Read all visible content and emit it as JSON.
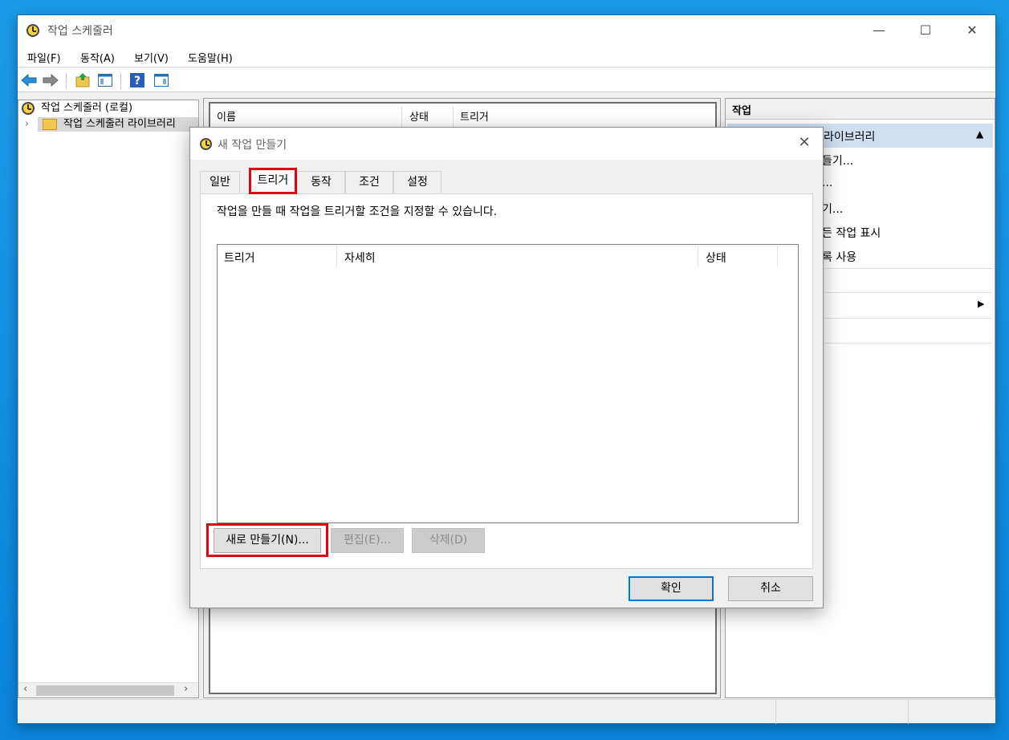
{
  "window": {
    "title": "작업 스케줄러",
    "controls": {
      "minimize": "—",
      "maximize": "☐",
      "close": "✕"
    }
  },
  "menubar": {
    "items": [
      "파일(F)",
      "동작(A)",
      "보기(V)",
      "도움말(H)"
    ]
  },
  "toolbar": {
    "icons": [
      "back-arrow-icon",
      "forward-arrow-icon",
      "up-folder-icon",
      "show-pane-icon",
      "help-icon",
      "show-action-pane-icon"
    ]
  },
  "tree": {
    "root": "작업 스케줄러 (로컬)",
    "child": "작업 스케줄러 라이브러리",
    "expander": "›",
    "scroll_left": "‹",
    "scroll_right": "›"
  },
  "center": {
    "columns": [
      "이름",
      "상태",
      "트리거"
    ]
  },
  "actions": {
    "header": "작업",
    "selected_group": "라이브러리",
    "items": [
      "들기...",
      "...",
      "기...",
      "든 작업 표시",
      "록 사용"
    ],
    "collapse_glyph": "▲",
    "submenu_glyph": "▶"
  },
  "dialog": {
    "title": "새 작업 만들기",
    "close": "✕",
    "tabs": [
      "일반",
      "트리거",
      "동작",
      "조건",
      "설정"
    ],
    "active_tab": "트리거",
    "description": "작업을 만들 때 작업을 트리거할 조건을 지정할 수 있습니다.",
    "list_columns": [
      "트리거",
      "자세히",
      "상태"
    ],
    "buttons": {
      "new": "새로 만들기(N)...",
      "edit": "편집(E)...",
      "delete": "삭제(D)"
    },
    "ok": "확인",
    "cancel": "취소"
  },
  "colors": {
    "highlight": "#e60012",
    "selection": "#cfe0f2",
    "default_button_border": "#0078d7",
    "desktop": "#1b9be6"
  }
}
